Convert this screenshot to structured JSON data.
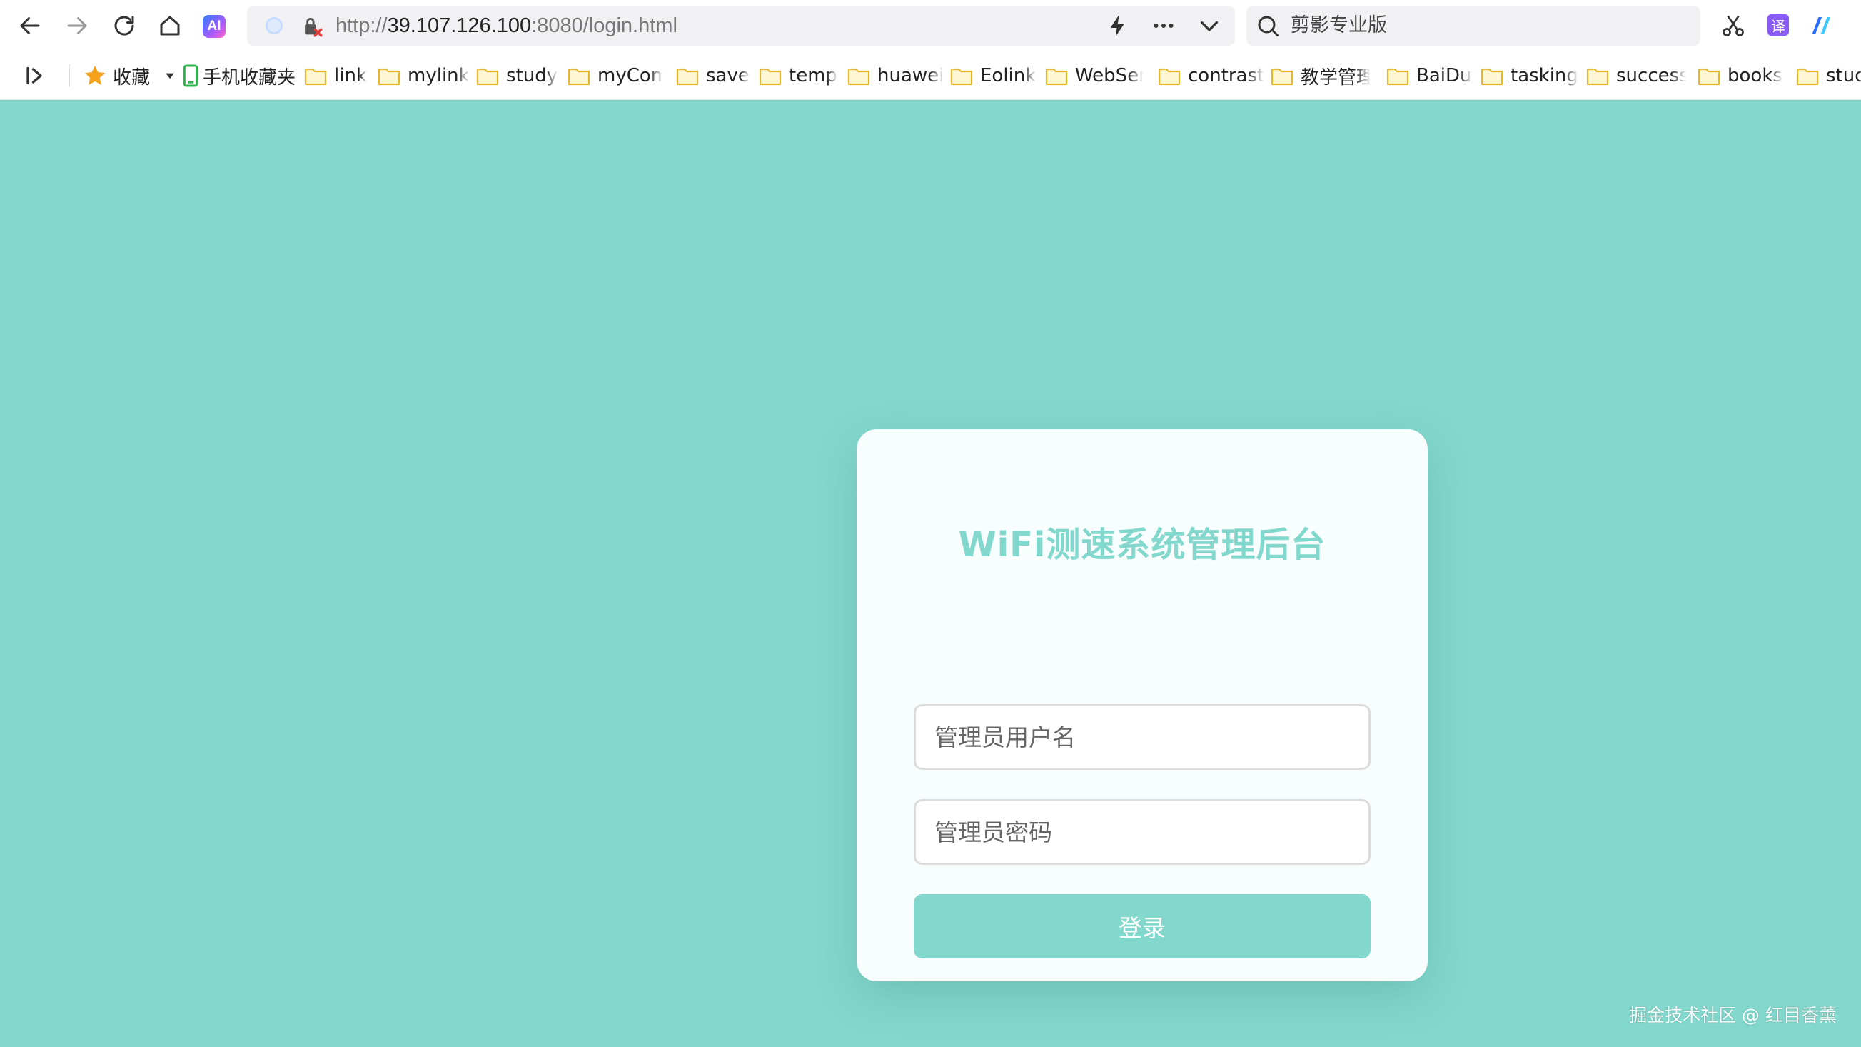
{
  "browser": {
    "address": {
      "scheme": "http://",
      "host": "39.107.126.100",
      "rest": ":8080/login.html"
    },
    "search": {
      "text": "剪影专业版"
    },
    "ai_badge": "AI",
    "translate_badge": "译"
  },
  "bookmarks": {
    "favorites_label": "收藏",
    "mobile_label": "手机收藏夹",
    "folders": [
      "link",
      "mylink",
      "study",
      "myCom",
      "save",
      "temp",
      "huawei",
      "Eolink",
      "WebSer",
      "contrast",
      "教学管理",
      "BaiDu",
      "tasking",
      "success",
      "books",
      "stud"
    ]
  },
  "login": {
    "title": "WiFi测速系统管理后台",
    "username_placeholder": "管理员用户名",
    "password_placeholder": "管理员密码",
    "submit_label": "登录"
  },
  "watermark": "掘金技术社区 @ 红目香薰",
  "colors": {
    "page_background": "#83d8cd",
    "accent": "#83d8cd",
    "card_background": "#f8fdfd"
  }
}
